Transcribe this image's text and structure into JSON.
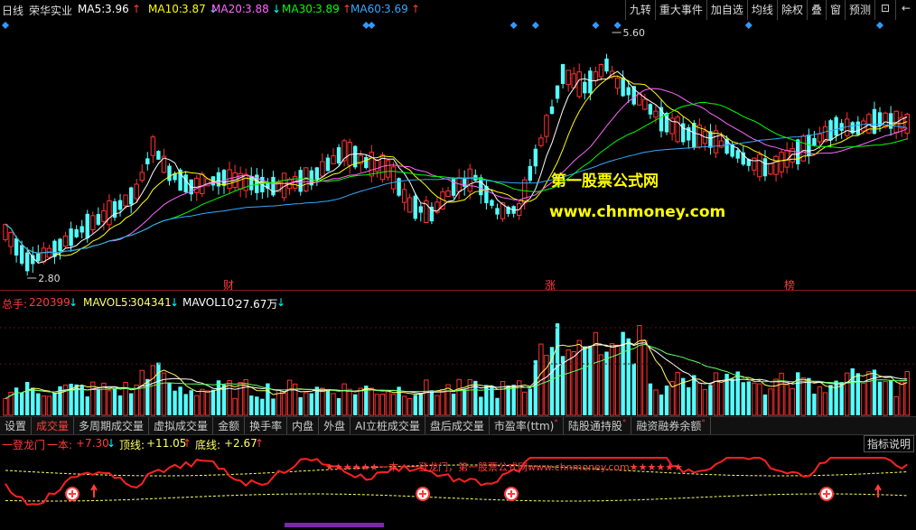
{
  "header": {
    "period": "日线",
    "stock_name": "荣华实业",
    "ma": [
      {
        "label": "MA5:",
        "value": "3.96",
        "arrow": "↑",
        "color": "#ffffff",
        "arrow_color": "#ff3c3c"
      },
      {
        "label": "MA10:",
        "value": "3.87",
        "arrow": "↓",
        "color": "#ffff00",
        "arrow_color": "#00ffff"
      },
      {
        "label": "MA20:",
        "value": "3.88",
        "arrow": "↓",
        "color": "#ff66ff",
        "arrow_color": "#00ffff"
      },
      {
        "label": "MA30:",
        "value": "3.89",
        "arrow": "↑",
        "color": "#00ff00",
        "arrow_color": "#ff3c3c"
      },
      {
        "label": "MA60:",
        "value": "3.69",
        "arrow": "↑",
        "color": "#33aaff",
        "arrow_color": "#ff3c3c"
      }
    ]
  },
  "toolbar": [
    "九转",
    "重大事件",
    "加自选",
    "均线",
    "除权",
    "叠",
    "窗",
    "预测"
  ],
  "toolbar_icons": [
    "lock-icon",
    "arrow-left-icon"
  ],
  "price_panel": {
    "high_label": "5.60",
    "low_label": "2.80",
    "watermark_title": "第一股票公式网",
    "watermark_url": "www.chnmoney.com",
    "event_markers": [
      "财",
      "涨",
      "榜"
    ]
  },
  "volume_header": {
    "total": {
      "label": "总手:",
      "value": "220399",
      "arrow": "↓"
    },
    "mavol5": {
      "label": "MAVOL5:",
      "value": "304341",
      "arrow": "↓"
    },
    "mavol10": {
      "label": "MAVOL10:",
      "value": "27.67万",
      "arrow": "↓"
    }
  },
  "tabs": [
    {
      "label": "设置",
      "active": false,
      "sup": ""
    },
    {
      "label": "成交量",
      "active": true,
      "sup": ""
    },
    {
      "label": "多周期成交量",
      "active": false,
      "sup": ""
    },
    {
      "label": "虚拟成交量",
      "active": false,
      "sup": ""
    },
    {
      "label": "金额",
      "active": false,
      "sup": ""
    },
    {
      "label": "换手率",
      "active": false,
      "sup": ""
    },
    {
      "label": "内盘",
      "active": false,
      "sup": ""
    },
    {
      "label": "外盘",
      "active": false,
      "sup": ""
    },
    {
      "label": "AI立桩成交量",
      "active": false,
      "sup": ""
    },
    {
      "label": "盘后成交量",
      "active": false,
      "sup": ""
    },
    {
      "label": "市盈率(ttm)",
      "active": false,
      "sup": "°"
    },
    {
      "label": "陆股通持股",
      "active": false,
      "sup": "°"
    },
    {
      "label": "融资融券余额",
      "active": false,
      "sup": "°"
    }
  ],
  "indicator_header": {
    "name": "一登龙门",
    "line1": {
      "label": "一本:",
      "value": "+7.30",
      "arrow": "↓"
    },
    "line2": {
      "label": "顶线:",
      "value": "+11.05",
      "arrow": "↑"
    },
    "line3": {
      "label": "底线:",
      "value": "+2.67",
      "arrow": "↑"
    },
    "help": "指标说明"
  },
  "indicator_panel": {
    "banner": "★★★★★★一本一一登龙门，第一股票公式网www.chnmoney.com★★★★★★"
  },
  "colors": {
    "up": "#ff3232",
    "down": "#54ffff",
    "blue_marker": "#3399ff",
    "background": "#000000"
  }
}
